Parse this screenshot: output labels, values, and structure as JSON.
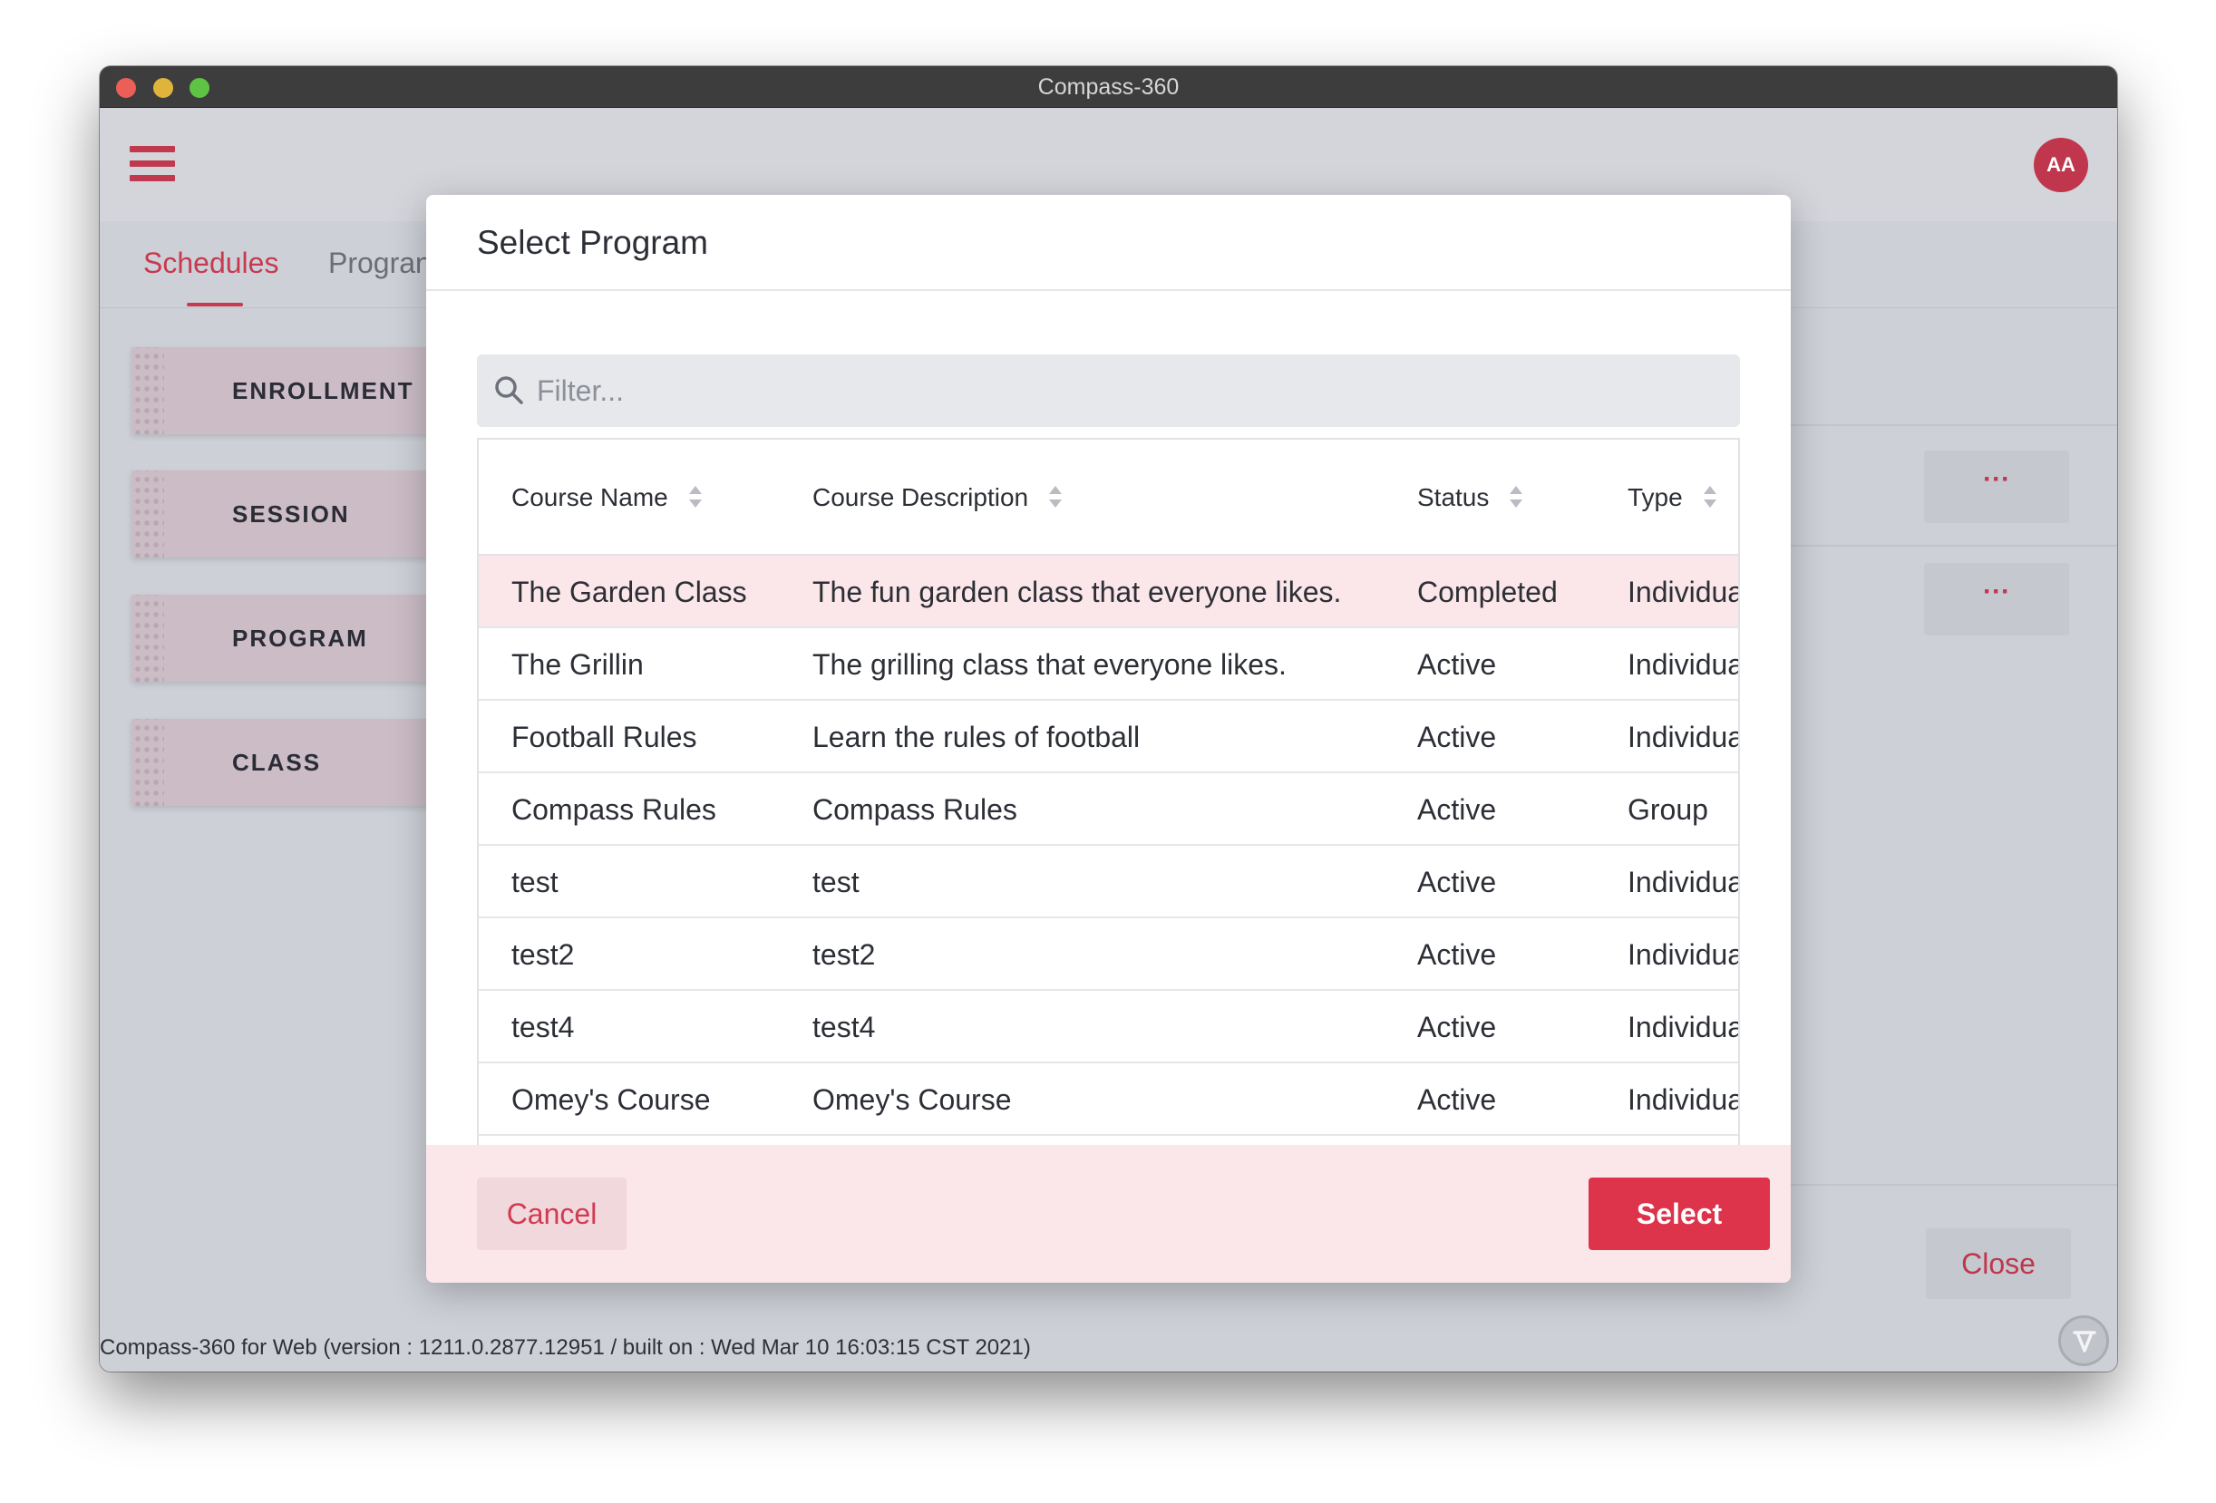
{
  "window": {
    "title": "Compass-360"
  },
  "header": {
    "avatar_initials": "AA",
    "accent_color": "#c0364c"
  },
  "tabs": [
    {
      "label": "Schedules",
      "active": true
    },
    {
      "label": "Progran",
      "active": false
    }
  ],
  "sidebar": {
    "items": [
      {
        "label": "ENROLLMENT"
      },
      {
        "label": "SESSION"
      },
      {
        "label": "PROGRAM"
      },
      {
        "label": "CLASS"
      }
    ]
  },
  "right_panel": {
    "more_label": "···",
    "close_label": "Close"
  },
  "footer": {
    "version_text": "Compass-360 for Web (version : 1211.0.2877.12951 / built on : Wed Mar 10 16:03:15 CST 2021)"
  },
  "modal": {
    "title": "Select Program",
    "filter": {
      "placeholder": "Filter...",
      "value": ""
    },
    "columns": [
      "Course Name",
      "Course Description",
      "Status",
      "Type"
    ],
    "rows": [
      {
        "name": "The Garden Class",
        "description": "The fun garden class that everyone likes.",
        "status": "Completed",
        "type": "Individual",
        "selected": true
      },
      {
        "name": "The Grillin",
        "description": "The grilling class that everyone likes.",
        "status": "Active",
        "type": "Individual"
      },
      {
        "name": "Football Rules",
        "description": "Learn the rules of football",
        "status": "Active",
        "type": "Individual"
      },
      {
        "name": "Compass Rules",
        "description": "Compass Rules",
        "status": "Active",
        "type": "Group"
      },
      {
        "name": "test",
        "description": "test",
        "status": "Active",
        "type": "Individual"
      },
      {
        "name": "test2",
        "description": "test2",
        "status": "Active",
        "type": "Individual"
      },
      {
        "name": "test4",
        "description": "test4",
        "status": "Active",
        "type": "Individual"
      },
      {
        "name": "Omey's Course",
        "description": "Omey's Course",
        "status": "Active",
        "type": "Individual"
      }
    ],
    "cancel_label": "Cancel",
    "select_label": "Select",
    "select_color": "#dd334b"
  }
}
